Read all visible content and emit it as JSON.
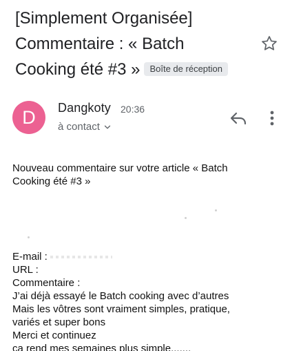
{
  "subject": {
    "line1": "[Simplement Organisée]",
    "line2": "Commentaire : « Batch",
    "line3": "Cooking été #3 »",
    "label": "Boîte de réception"
  },
  "icons": {
    "star": "star-outline-icon",
    "reply": "reply-icon",
    "more": "more-vertical-icon",
    "expand": "chevron-down-icon"
  },
  "sender": {
    "avatar_letter": "D",
    "avatar_color": "#ec6192",
    "name": "Dangkoty",
    "time": "20:36",
    "to": "à contact"
  },
  "body": {
    "intro_line1": "Nouveau commentaire sur votre article « Batch",
    "intro_line2": "Cooking été #3 »",
    "email_label": "E-mail :",
    "url_label": "URL :",
    "comment_label": "Commentaire :",
    "comment_lines": [
      "J’ai déjà essayé le Batch cooking avec d’autres",
      "Mais les vôtres  sont vraiment simples, pratique,",
      "variés et super bons",
      "Merci et continuez",
      "ça rend mes semaines plus  simple......."
    ]
  }
}
